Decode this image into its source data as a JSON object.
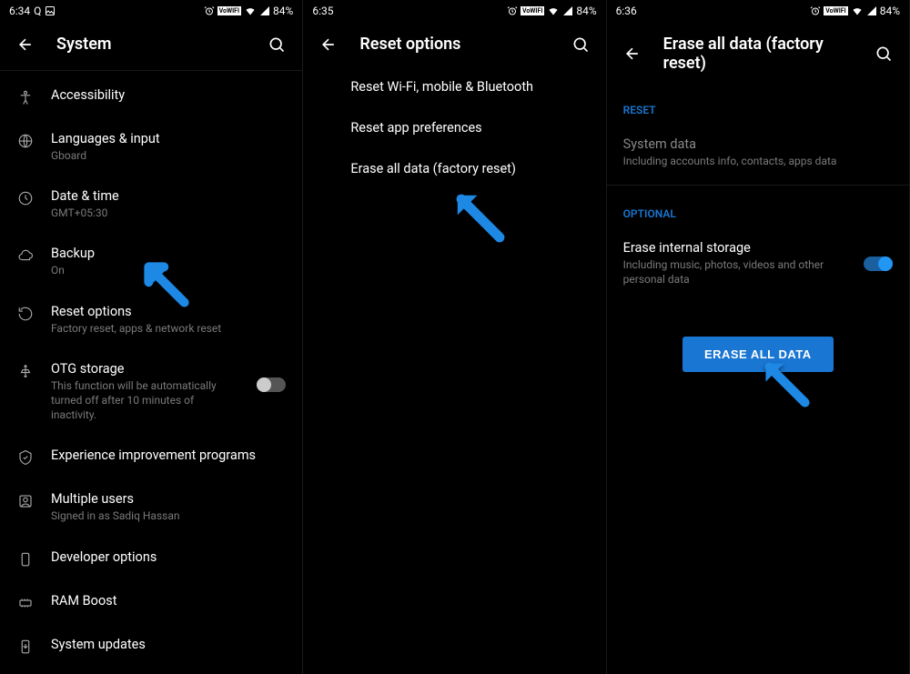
{
  "status": {
    "times": [
      "6:34",
      "6:35",
      "6:36"
    ],
    "battery": "84%",
    "wifi_label": "VoWIFI"
  },
  "screen1": {
    "title": "System",
    "items": [
      {
        "title": "Accessibility",
        "sub": ""
      },
      {
        "title": "Languages & input",
        "sub": "Gboard"
      },
      {
        "title": "Date & time",
        "sub": "GMT+05:30"
      },
      {
        "title": "Backup",
        "sub": "On"
      },
      {
        "title": "Reset options",
        "sub": "Factory reset, apps & network reset"
      },
      {
        "title": "OTG storage",
        "sub": "This function will be automatically turned off after 10 minutes of inactivity."
      },
      {
        "title": "Experience improvement programs",
        "sub": ""
      },
      {
        "title": "Multiple users",
        "sub": "Signed in as Sadiq Hassan"
      },
      {
        "title": "Developer options",
        "sub": ""
      },
      {
        "title": "RAM Boost",
        "sub": ""
      },
      {
        "title": "System updates",
        "sub": ""
      }
    ]
  },
  "screen2": {
    "title": "Reset options",
    "items": [
      "Reset Wi-Fi, mobile & Bluetooth",
      "Reset app preferences",
      "Erase all data (factory reset)"
    ]
  },
  "screen3": {
    "title": "Erase all data (factory reset)",
    "reset_label": "RESET",
    "system_data": {
      "title": "System data",
      "sub": "Including accounts info, contacts, apps data"
    },
    "optional_label": "OPTIONAL",
    "erase_storage": {
      "title": "Erase internal storage",
      "sub": "Including music, photos, videos and other personal data"
    },
    "button": "ERASE ALL DATA"
  }
}
